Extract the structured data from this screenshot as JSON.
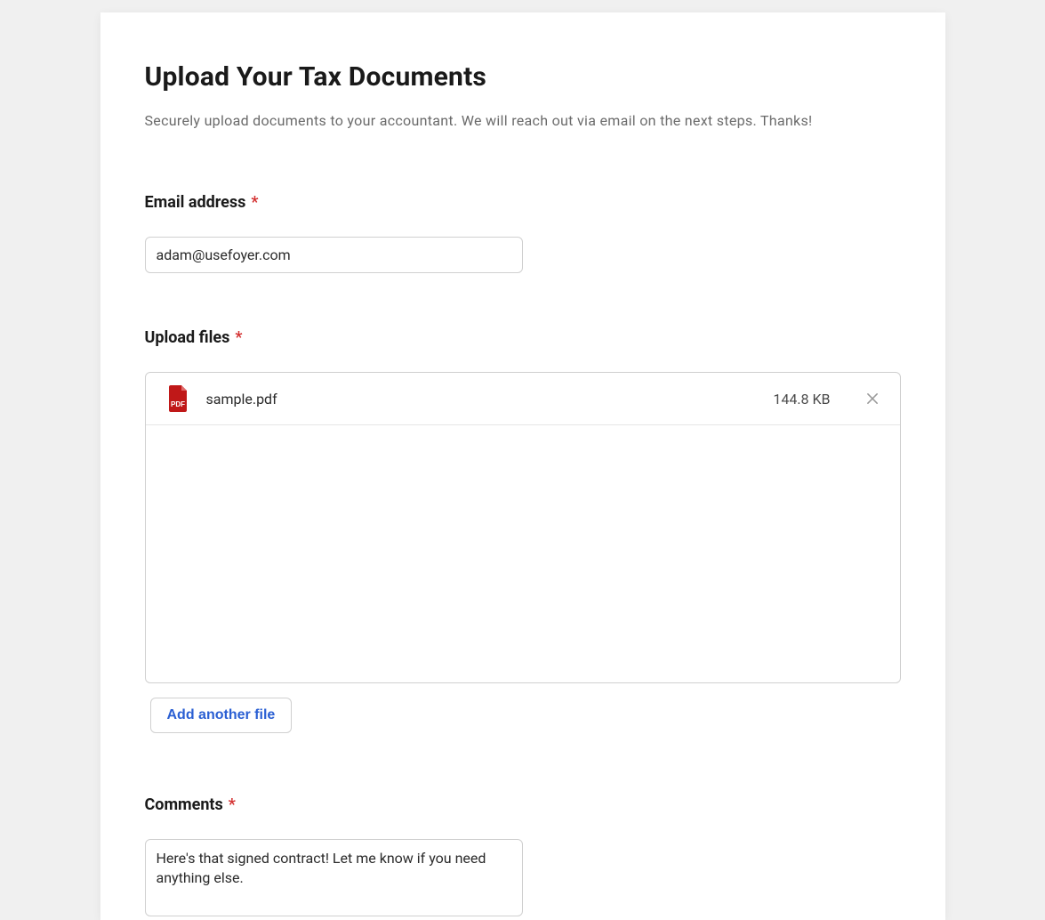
{
  "header": {
    "title": "Upload Your Tax Documents",
    "subtitle": "Securely upload documents to your accountant. We will reach out via email on the next steps. Thanks!"
  },
  "email": {
    "label": "Email address",
    "required": "*",
    "value": "adam@usefoyer.com"
  },
  "upload": {
    "label": "Upload files",
    "required": "*",
    "files": [
      {
        "name": "sample.pdf",
        "size": "144.8 KB",
        "icon_label": "PDF"
      }
    ],
    "add_label": "Add another file"
  },
  "comments": {
    "label": "Comments",
    "required": "*",
    "value": "Here's that signed contract! Let me know if you need anything else."
  }
}
